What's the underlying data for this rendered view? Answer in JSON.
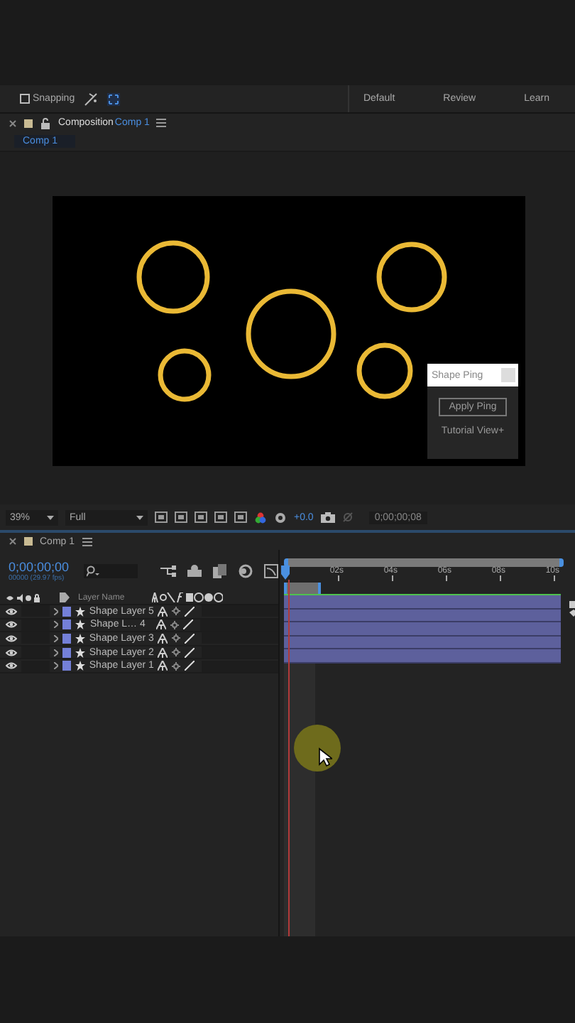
{
  "toolbar": {
    "snapping": {
      "label": "Snapping",
      "checked": false
    },
    "workspaces": [
      {
        "label": "Default",
        "selected": false
      },
      {
        "label": "Review",
        "selected": false
      },
      {
        "label": "Learn",
        "selected": false
      }
    ]
  },
  "composition_panel": {
    "title": "Composition",
    "comp_name": "Comp 1",
    "tabs": [
      {
        "label": "Comp 1",
        "selected": true
      }
    ]
  },
  "viewer": {
    "plugin_panel": {
      "field_value": "Shape Ping",
      "button": "Apply Ping",
      "footer": "Tutorial View+"
    }
  },
  "viewer_toolbar": {
    "zoom": "39%",
    "resolution": "Full",
    "exposure": "+0.0",
    "timecode": "0;00;00;08"
  },
  "timeline": {
    "tab": "Comp 1",
    "timecode": "0;00;00;00",
    "frame_info": "00000 (29.97 fps)",
    "column_header": "Layer Name",
    "ruler": [
      "02s",
      "04s",
      "06s",
      "08s",
      "10s"
    ],
    "layers": [
      {
        "name": "Shape Layer 5",
        "visible": true
      },
      {
        "name": "Shape L… 4",
        "visible": true
      },
      {
        "name": "Shape Layer 3",
        "visible": true
      },
      {
        "name": "Shape Layer 2",
        "visible": true
      },
      {
        "name": "Shape Layer 1",
        "visible": true
      }
    ]
  }
}
